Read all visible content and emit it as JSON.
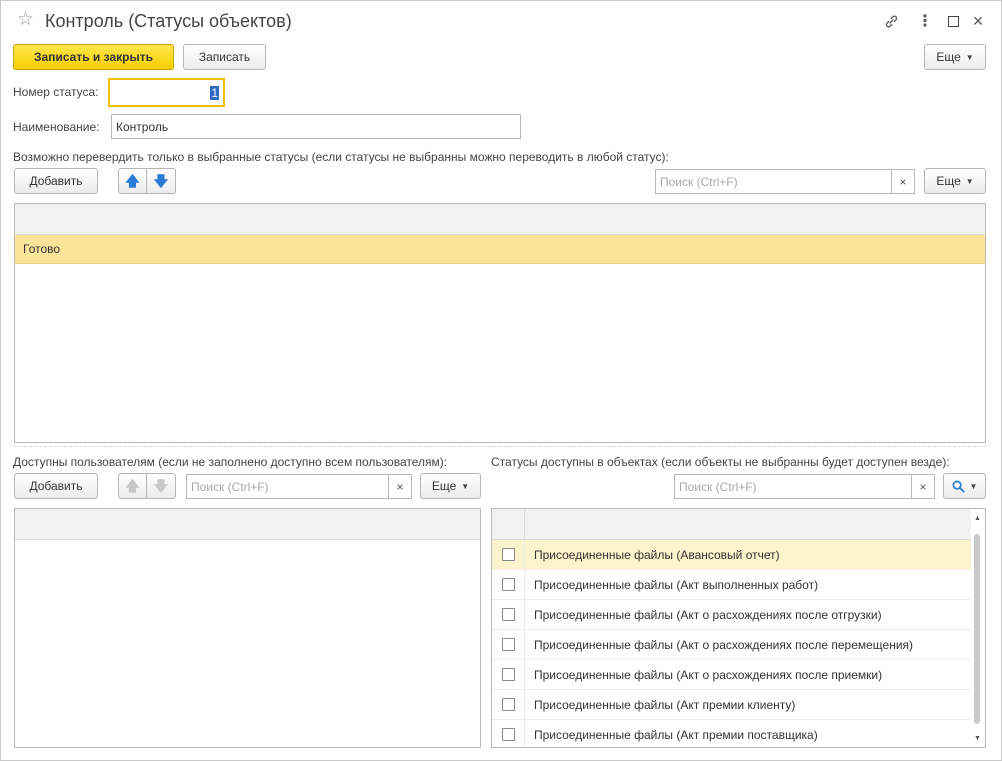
{
  "window": {
    "title": "Контроль (Статусы объектов)",
    "icons": [
      "star-icon",
      "link-icon",
      "more-menu-icon",
      "maximize-icon",
      "close-icon"
    ]
  },
  "toolbar": {
    "save_close_label": "Записать и закрыть",
    "save_label": "Записать",
    "more_label": "Еще"
  },
  "form": {
    "status_number_label": "Номер статуса:",
    "status_number_value": "1",
    "name_label": "Наименование:",
    "name_value": "Контроль"
  },
  "allowed_statuses": {
    "caption": "Возможно перевердить только в выбранные статусы (если статусы не выбранны можно переводить в любой статус):",
    "add_label": "Добавить",
    "search_placeholder": "Поиск (Ctrl+F)",
    "clear_glyph": "×",
    "more_label": "Еще",
    "rows": [
      "Готово"
    ]
  },
  "users": {
    "caption": "Доступны пользователям (если не заполнено доступно всем пользователям):",
    "add_label": "Добавить",
    "search_placeholder": "Поиск (Ctrl+F)",
    "clear_glyph": "×",
    "more_label": "Еще",
    "rows": []
  },
  "objects": {
    "caption": "Статусы доступны в объектах (если объекты не выбранны будет доступен везде):",
    "search_placeholder": "Поиск (Ctrl+F)",
    "clear_glyph": "×",
    "rows": [
      {
        "label": "Присоединенные файлы (Авансовый отчет)",
        "checked": false
      },
      {
        "label": "Присоединенные файлы (Акт выполненных работ)",
        "checked": false
      },
      {
        "label": "Присоединенные файлы (Акт о расхождениях после отгрузки)",
        "checked": false
      },
      {
        "label": "Присоединенные файлы (Акт о расхождениях после перемещения)",
        "checked": false
      },
      {
        "label": "Присоединенные файлы (Акт о расхождениях после приемки)",
        "checked": false
      },
      {
        "label": "Присоединенные файлы (Акт премии клиенту)",
        "checked": false
      },
      {
        "label": "Присоединенные файлы (Акт премии поставщика)",
        "checked": false
      }
    ]
  },
  "colors": {
    "primary_button": "#f5cf00",
    "selected_row": "#fbe39a",
    "arrow_blue": "#2a7bd6"
  }
}
